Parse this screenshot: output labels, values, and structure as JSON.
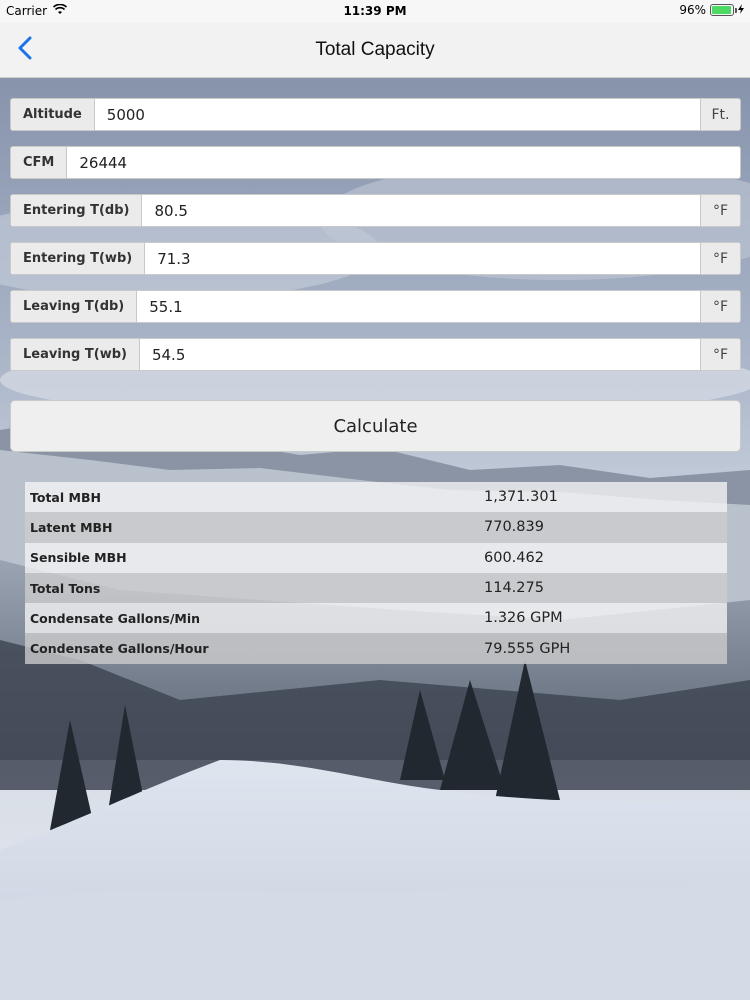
{
  "status_bar": {
    "carrier": "Carrier",
    "time": "11:39 PM",
    "battery": "96%",
    "battery_level": 0.96
  },
  "nav": {
    "title": "Total Capacity",
    "back_icon": "chevron-left-icon"
  },
  "inputs": [
    {
      "label": "Altitude",
      "value": "5000",
      "unit": "Ft."
    },
    {
      "label": "CFM",
      "value": "26444",
      "unit": ""
    },
    {
      "label": "Entering T(db)",
      "value": "80.5",
      "unit": "°F"
    },
    {
      "label": "Entering T(wb)",
      "value": "71.3",
      "unit": "°F"
    },
    {
      "label": "Leaving T(db)",
      "value": "55.1",
      "unit": "°F"
    },
    {
      "label": "Leaving T(wb)",
      "value": "54.5",
      "unit": "°F"
    }
  ],
  "calculate_label": "Calculate",
  "results": [
    {
      "label": "Total MBH",
      "value": "1,371.301"
    },
    {
      "label": "Latent MBH",
      "value": "770.839"
    },
    {
      "label": "Sensible MBH",
      "value": "600.462"
    },
    {
      "label": "Total Tons",
      "value": "114.275"
    },
    {
      "label": "Condensate Gallons/Min",
      "value": "1.326 GPM"
    },
    {
      "label": "Condensate Gallons/Hour",
      "value": "79.555 GPH"
    }
  ],
  "colors": {
    "accent": "#1a73e8",
    "battery": "#4cd964"
  }
}
